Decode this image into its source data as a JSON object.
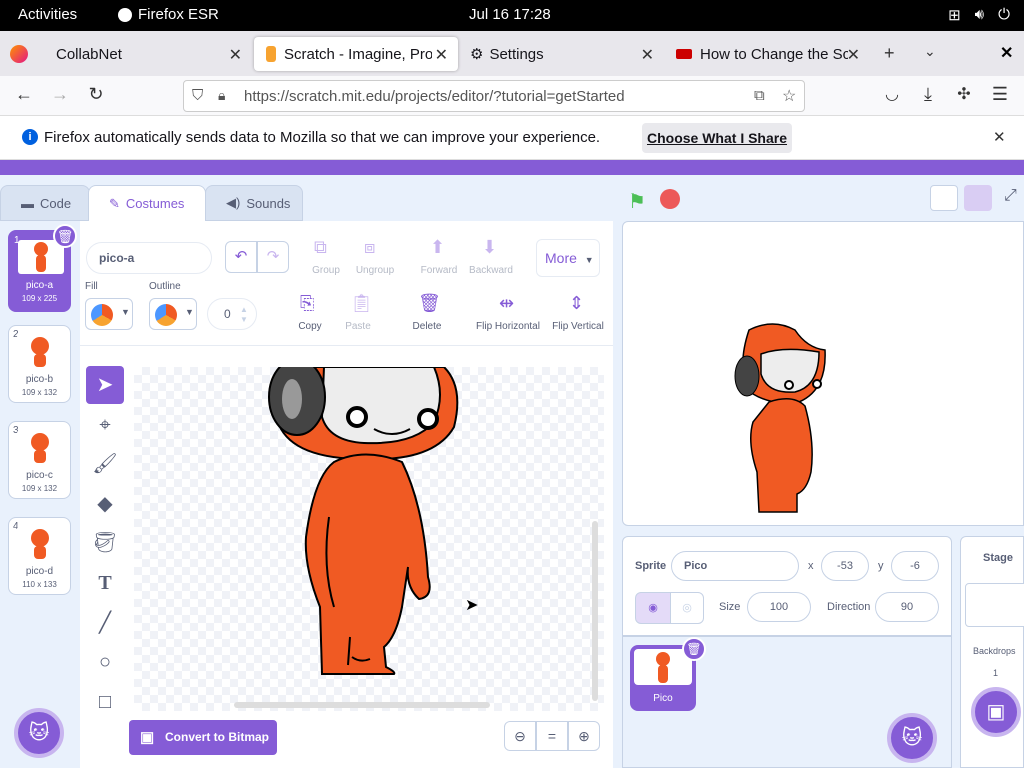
{
  "system": {
    "activities": "Activities",
    "app_name": "Firefox ESR",
    "clock": "Jul 16  17:28"
  },
  "browser": {
    "tabs": [
      {
        "label": "CollabNet"
      },
      {
        "label": "Scratch - Imagine, Prog"
      },
      {
        "label": "Settings"
      },
      {
        "label": "How to Change the Sc"
      }
    ],
    "url": "https://scratch.mit.edu/projects/editor/?tutorial=getStarted",
    "notification": {
      "message": "Firefox automatically sends data to Mozilla so that we can improve your experience.",
      "button": "Choose What I Share"
    }
  },
  "scratch": {
    "tabs": {
      "code": "Code",
      "costumes": "Costumes",
      "sounds": "Sounds"
    },
    "costumes": [
      {
        "num": "1",
        "name": "pico-a",
        "dim": "109 x 225"
      },
      {
        "num": "2",
        "name": "pico-b",
        "dim": "109 x 132"
      },
      {
        "num": "3",
        "name": "pico-c",
        "dim": "109 x 132"
      },
      {
        "num": "4",
        "name": "pico-d",
        "dim": "110 x 133"
      }
    ],
    "editor": {
      "costume_name": "pico-a",
      "group": "Group",
      "ungroup": "Ungroup",
      "forward": "Forward",
      "backward": "Backward",
      "more": "More",
      "fill": "Fill",
      "outline": "Outline",
      "outline_width": "0",
      "copy": "Copy",
      "paste": "Paste",
      "delete": "Delete",
      "flip_h": "Flip Horizontal",
      "flip_v": "Flip Vertical",
      "convert": "Convert to Bitmap"
    },
    "sprite": {
      "label": "Sprite",
      "name": "Pico",
      "x_label": "x",
      "x": "-53",
      "y_label": "y",
      "y": "-6",
      "size_label": "Size",
      "size": "100",
      "direction_label": "Direction",
      "direction": "90",
      "thumb_name": "Pico"
    },
    "stage": {
      "label": "Stage",
      "backdrops_label": "Backdrops",
      "backdrops_count": "1"
    },
    "colors": {
      "accent": "#855cd6",
      "orange": "#f05a23",
      "green_flag": "#4cbf56",
      "stop": "#ec5959"
    }
  }
}
